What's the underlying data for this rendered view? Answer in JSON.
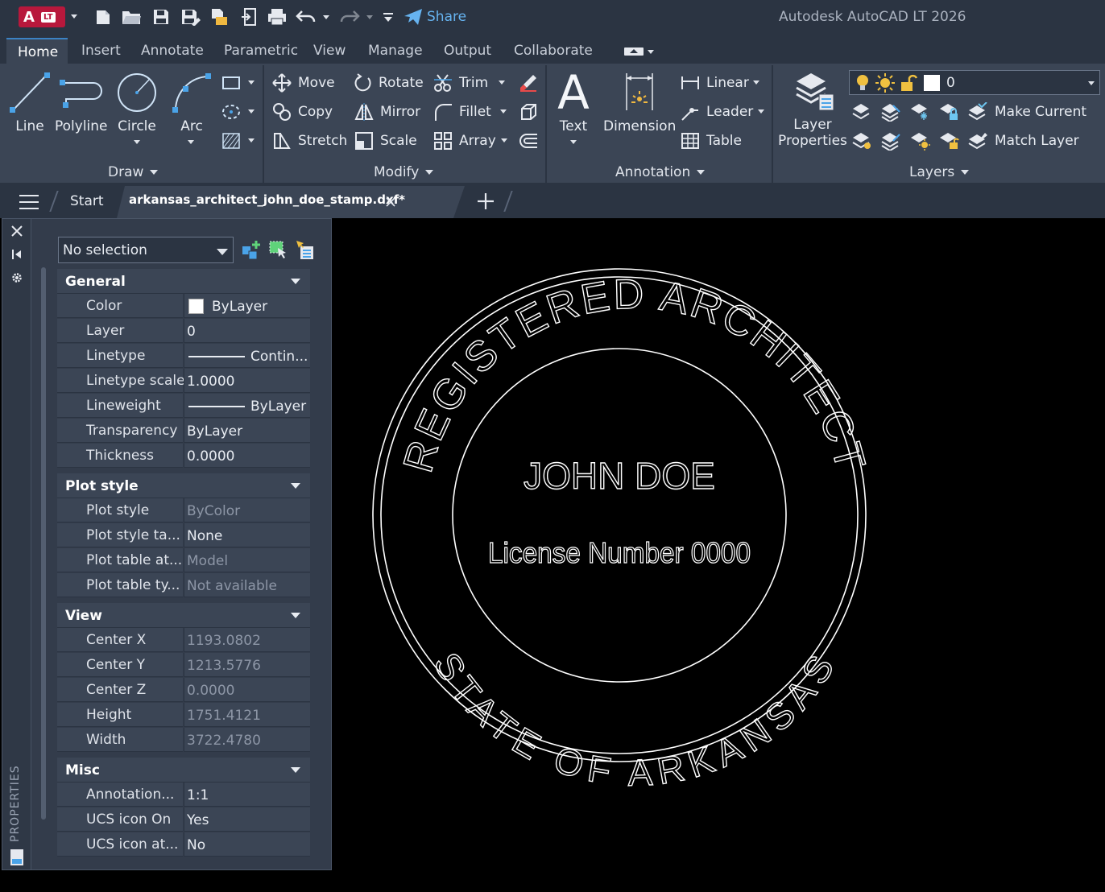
{
  "titlebar": {
    "app_badge": "A",
    "app_badge_lt": "LT",
    "share_label": "Share",
    "app_title": "Autodesk AutoCAD LT 2026"
  },
  "ribbon_tabs": [
    "Home",
    "Insert",
    "Annotate",
    "Parametric",
    "View",
    "Manage",
    "Output",
    "Collaborate"
  ],
  "ribbon": {
    "draw": {
      "title": "Draw",
      "line": "Line",
      "polyline": "Polyline",
      "circle": "Circle",
      "arc": "Arc"
    },
    "modify": {
      "title": "Modify",
      "move": "Move",
      "rotate": "Rotate",
      "trim": "Trim",
      "copy": "Copy",
      "mirror": "Mirror",
      "fillet": "Fillet",
      "stretch": "Stretch",
      "scale": "Scale",
      "array": "Array"
    },
    "annotation": {
      "title": "Annotation",
      "text": "Text",
      "dimension": "Dimension",
      "linear": "Linear",
      "leader": "Leader",
      "table": "Table"
    },
    "layers": {
      "title": "Layers",
      "layer_properties_1": "Layer",
      "layer_properties_2": "Properties",
      "current_layer": "0",
      "make_current": "Make Current",
      "match_layer": "Match Layer"
    }
  },
  "doc_tabs": {
    "start": "Start",
    "file": "arkansas_architect_john_doe_stamp.dxf*"
  },
  "palette": {
    "side_label": "PROPERTIES",
    "selection": "No selection",
    "sections": {
      "general": {
        "title": "General",
        "rows": [
          {
            "name": "Color",
            "value": "ByLayer"
          },
          {
            "name": "Layer",
            "value": "0"
          },
          {
            "name": "Linetype",
            "value": "Contin..."
          },
          {
            "name": "Linetype scale",
            "value": "1.0000"
          },
          {
            "name": "Lineweight",
            "value": "ByLayer"
          },
          {
            "name": "Transparency",
            "value": "ByLayer"
          },
          {
            "name": "Thickness",
            "value": "0.0000"
          }
        ]
      },
      "plot_style": {
        "title": "Plot style",
        "rows": [
          {
            "name": "Plot style",
            "value": "ByColor"
          },
          {
            "name": "Plot style ta...",
            "value": "None"
          },
          {
            "name": "Plot table at...",
            "value": "Model"
          },
          {
            "name": "Plot table ty...",
            "value": "Not available"
          }
        ]
      },
      "view": {
        "title": "View",
        "rows": [
          {
            "name": "Center X",
            "value": "1193.0802"
          },
          {
            "name": "Center Y",
            "value": "1213.5776"
          },
          {
            "name": "Center Z",
            "value": "0.0000"
          },
          {
            "name": "Height",
            "value": "1751.4121"
          },
          {
            "name": "Width",
            "value": "3722.4780"
          }
        ]
      },
      "misc": {
        "title": "Misc",
        "rows": [
          {
            "name": "Annotation...",
            "value": "1:1"
          },
          {
            "name": "UCS icon On",
            "value": "Yes"
          },
          {
            "name": "UCS icon at...",
            "value": "No"
          }
        ]
      }
    }
  },
  "stamp": {
    "top_arc": "REGISTERED ARCHITECT",
    "name": "JOHN DOE",
    "license": "License Number 0000",
    "bottom_arc": "STATE OF ARKANSAS"
  },
  "colors": {
    "accent": "#3b82c4",
    "share": "#66b3f0",
    "brand": "#b8183c",
    "panel": "#3b4555",
    "background": "#2b3442"
  }
}
